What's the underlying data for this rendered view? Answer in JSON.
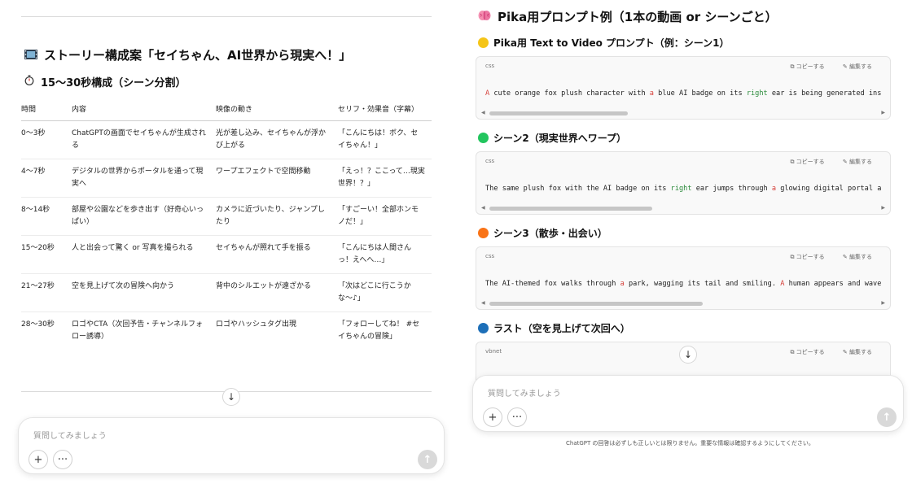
{
  "left": {
    "heading": "ストーリー構成案「セイちゃん、AI世界から現実へ！」",
    "subheading": "15〜30秒構成（シーン分割）",
    "table": {
      "headers": [
        "時間",
        "内容",
        "映像の動き",
        "セリフ・効果音（字幕）"
      ],
      "rows": [
        [
          "0〜3秒",
          "ChatGPTの画面でセイちゃんが生成される",
          "光が差し込み、セイちゃんが浮かび上がる",
          "「こんにちは！ボク、セイちゃん！」"
        ],
        [
          "4〜7秒",
          "デジタルの世界からポータルを通って現実へ",
          "ワープエフェクトで空間移動",
          "「えっ！？ここって…現実世界！？」"
        ],
        [
          "8〜14秒",
          "部屋や公園などを歩き出す（好奇心いっぱい）",
          "カメラに近づいたり、ジャンプしたり",
          "「すごーい！全部ホンモノだ！」"
        ],
        [
          "15〜20秒",
          "人と出会って驚く or 写真を撮られる",
          "セイちゃんが照れて手を振る",
          "「こんにちは人間さんっ！えへへ…」"
        ],
        [
          "21〜27秒",
          "空を見上げて次の冒険へ向かう",
          "背中のシルエットが遠ざかる",
          "「次はどこに行こうかな〜♪」"
        ],
        [
          "28〜30秒",
          "ロゴやCTA（次回予告・チャンネルフォロー誘導）",
          "ロゴやハッシュタグ出現",
          "「フォローしてね！ #セイちゃんの冒険」"
        ]
      ]
    },
    "composer": {
      "placeholder": "質問してみましょう"
    }
  },
  "right": {
    "title": "Pika用プロンプト例（1本の動画 or シーンごと）",
    "code_actions": {
      "copy": "コピーする",
      "edit": "編集する"
    },
    "sections": [
      {
        "heading": "Pika用 Text to Video プロンプト（例：シーン1）",
        "dot_color": "#f5c518",
        "lang": "css",
        "code": [
          {
            "t": "A",
            "c": "red"
          },
          {
            "t": " cute orange fox plush character with "
          },
          {
            "t": "a",
            "c": "red"
          },
          {
            "t": " blue AI badge on its "
          },
          {
            "t": "right",
            "c": "green"
          },
          {
            "t": " ear is being generated ins"
          }
        ]
      },
      {
        "heading": "シーン2（現実世界へワープ）",
        "dot_color": "#22c55e",
        "lang": "css",
        "code": [
          {
            "t": "The same plush fox with the AI badge on its "
          },
          {
            "t": "right",
            "c": "green"
          },
          {
            "t": " ear jumps through "
          },
          {
            "t": "a",
            "c": "red"
          },
          {
            "t": " glowing digital portal a"
          }
        ]
      },
      {
        "heading": "シーン3（散歩・出会い）",
        "dot_color": "#f97316",
        "lang": "css",
        "code": [
          {
            "t": "The AI-themed fox walks through "
          },
          {
            "t": "a",
            "c": "red"
          },
          {
            "t": " park, wagging its tail and smiling. "
          },
          {
            "t": "A",
            "c": "red"
          },
          {
            "t": " human appears and wave"
          }
        ]
      },
      {
        "heading": "ラスト（空を見上げて次回へ）",
        "dot_color": "#1d6fb8",
        "lang": "vbnet",
        "code": []
      }
    ],
    "composer": {
      "placeholder": "質問してみましょう"
    },
    "disclaimer": "ChatGPT の回答は必ずしも正しいとは限りません。重要な情報は確認するようにしてください。"
  }
}
